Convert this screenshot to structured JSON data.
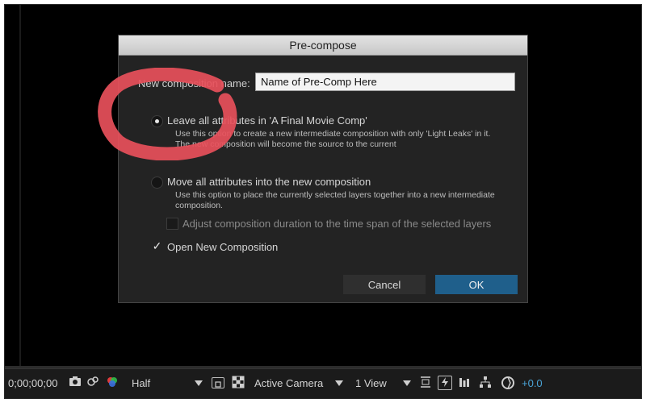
{
  "dialog": {
    "title": "Pre-compose",
    "name_label": "New composition name:",
    "name_value": "Name of Pre-Comp Here",
    "option_leave": {
      "label": "Leave all attributes in 'A Final Movie Comp'",
      "description": "Use this option to create a new intermediate composition with only 'Light Leaks' in it. The new composition will become the source to the current",
      "selected": true
    },
    "option_move": {
      "label": "Move all attributes into the new composition",
      "description": "Use this option to place the currently selected layers together into a new intermediate composition.",
      "selected": false
    },
    "adjust_duration": {
      "label": "Adjust composition duration to the time span of the selected layers",
      "checked": false,
      "disabled": true
    },
    "open_new": {
      "label": "Open New Composition",
      "checked": true
    },
    "cancel_label": "Cancel",
    "ok_label": "OK"
  },
  "annotation": {
    "color": "#e8505b"
  },
  "toolbar": {
    "timecode": "0;00;00;00",
    "resolution": "Half",
    "camera": "Active Camera",
    "views": "1 View",
    "exposure": "+0.0"
  },
  "colors": {
    "ok_button": "#1f5f8b",
    "exposure_text": "#4aa3d6"
  }
}
